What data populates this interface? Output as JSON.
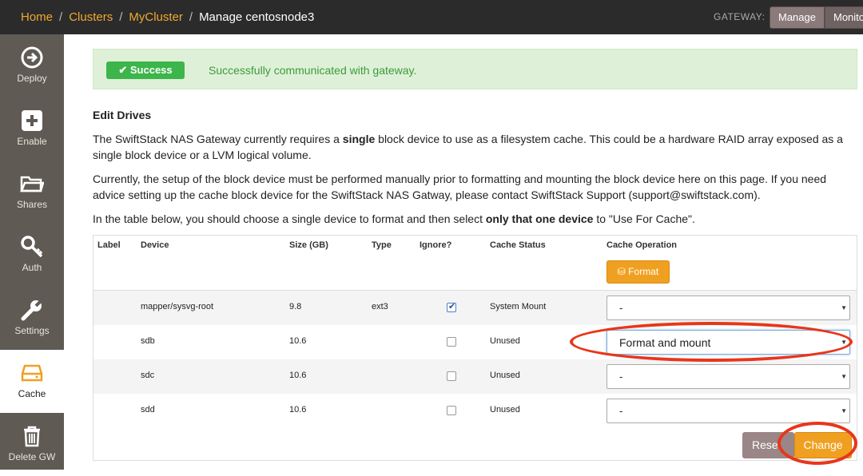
{
  "breadcrumb": {
    "home": "Home",
    "clusters": "Clusters",
    "cluster": "MyCluster",
    "current": "Manage centosnode3",
    "separator": "/"
  },
  "gateway": {
    "label": "GATEWAY:",
    "manage": "Manage",
    "monitor": "Monitor"
  },
  "sidebar": {
    "items": [
      {
        "label": "Deploy",
        "icon": "deploy-icon"
      },
      {
        "label": "Enable",
        "icon": "plus-icon"
      },
      {
        "label": "Shares",
        "icon": "folder-icon"
      },
      {
        "label": "Auth",
        "icon": "key-icon"
      },
      {
        "label": "Settings",
        "icon": "wrench-icon"
      },
      {
        "label": "Cache",
        "icon": "drive-icon"
      },
      {
        "label": "Delete GW",
        "icon": "trash-icon"
      }
    ]
  },
  "alert": {
    "badge": "Success",
    "message": "Successfully communicated with gateway."
  },
  "section": {
    "title": "Edit Drives",
    "p1_a": "The SwiftStack NAS Gateway currently requires a ",
    "p1_b": "single",
    "p1_c": " block device to use as a filesystem cache. This could be a hardware RAID array exposed as a single block device or a LVM logical volume.",
    "p2": "Currently, the setup of the block device must be performed manually prior to formatting and mounting the block device here on this page. If you need advice setting up the cache block device for the SwiftStack NAS Gatway, please contact SwiftStack Support (support@swiftstack.com).",
    "p3_a": "In the table below, you should choose a single device to format and then select ",
    "p3_b": "only that one device",
    "p3_c": " to \"Use For Cache\"."
  },
  "table": {
    "headers": {
      "label": "Label",
      "device": "Device",
      "size": "Size (GB)",
      "type": "Type",
      "ignore": "Ignore?",
      "cache_status": "Cache Status",
      "cache_operation": "Cache Operation"
    },
    "format_button": "Format",
    "rows": [
      {
        "label": "",
        "device": "mapper/sysvg-root",
        "size": "9.8",
        "type": "ext3",
        "ignore": true,
        "status": "System Mount",
        "operation": "-"
      },
      {
        "label": "",
        "device": "sdb",
        "size": "10.6",
        "type": "",
        "ignore": false,
        "status": "Unused",
        "operation": "Format and mount"
      },
      {
        "label": "",
        "device": "sdc",
        "size": "10.6",
        "type": "",
        "ignore": false,
        "status": "Unused",
        "operation": "-"
      },
      {
        "label": "",
        "device": "sdd",
        "size": "10.6",
        "type": "",
        "ignore": false,
        "status": "Unused",
        "operation": "-"
      }
    ],
    "reset_button": "Reset",
    "change_button": "Change"
  },
  "colors": {
    "accent": "#f0a020",
    "success": "#3cb54a",
    "annotation": "#e8361a"
  }
}
